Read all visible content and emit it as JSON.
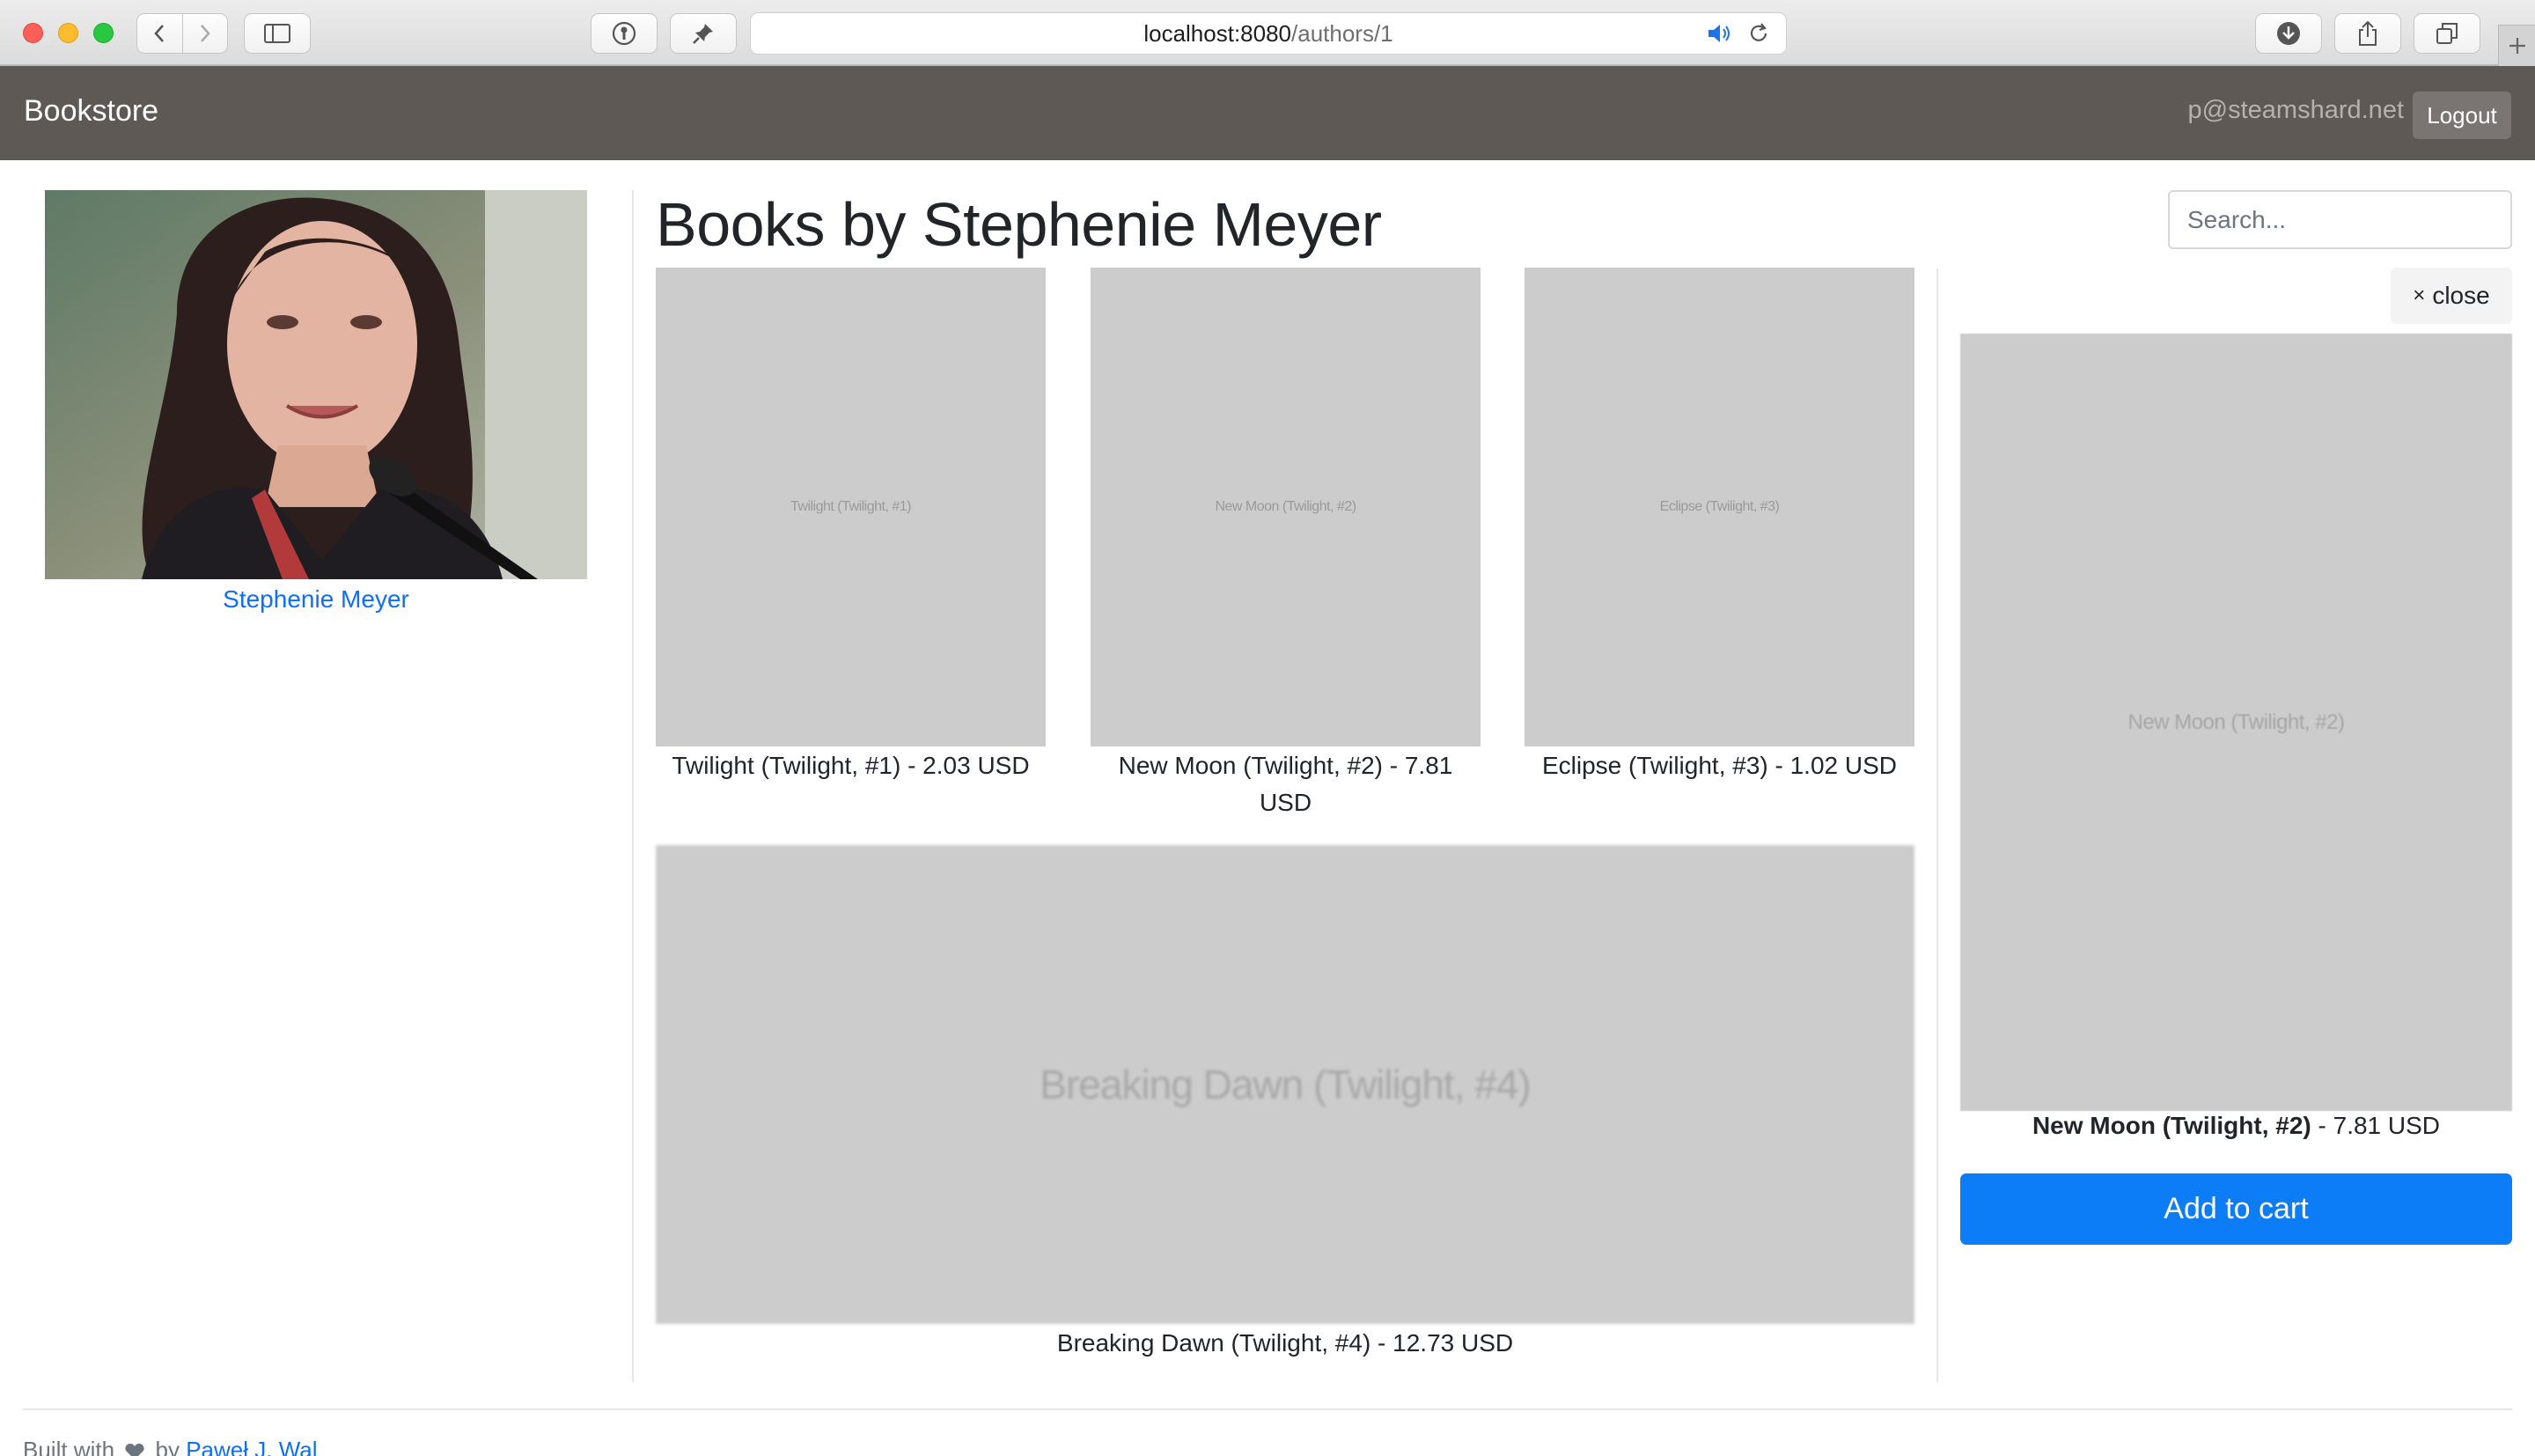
{
  "browser": {
    "url_host": "localhost:8080",
    "url_path": "/authors/1"
  },
  "navbar": {
    "brand": "Bookstore",
    "user_email": "p@steamshard.net",
    "logout_label": "Logout"
  },
  "author": {
    "name": "Stephenie Meyer"
  },
  "page": {
    "title": "Books by Stephenie Meyer",
    "search_placeholder": "Search..."
  },
  "books": [
    {
      "cover_text": "Twilight (Twilight, #1)",
      "caption": "Twilight (Twilight, #1) - 2.03 USD"
    },
    {
      "cover_text": "New Moon (Twilight, #2)",
      "caption": "New Moon (Twilight, #2) - 7.81 USD"
    },
    {
      "cover_text": "Eclipse (Twilight, #3)",
      "caption": "Eclipse (Twilight, #3) - 1.02 USD"
    },
    {
      "cover_text": "Breaking Dawn (Twilight, #4)",
      "caption": "Breaking Dawn (Twilight, #4) - 12.73 USD"
    }
  ],
  "detail": {
    "close_label": "close",
    "cover_text": "New Moon (Twilight, #2)",
    "title": "New Moon (Twilight, #2)",
    "price": " - 7.81 USD",
    "add_to_cart_label": "Add to cart"
  },
  "footer": {
    "built_with": "Built with",
    "by": "by",
    "author_link": "Paweł J. Wal"
  },
  "colors": {
    "navbar_bg": "#5f5955",
    "link": "#0d6efd",
    "primary_button": "#0d7cf7",
    "cover_placeholder": "#cccccc"
  }
}
